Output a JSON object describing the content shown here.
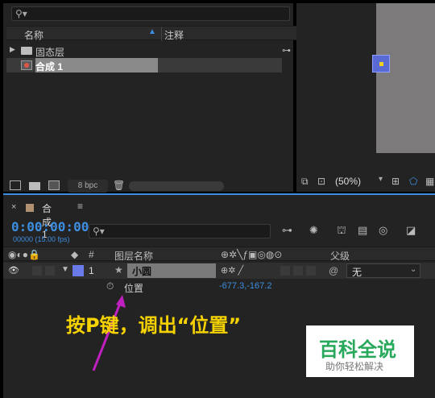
{
  "project": {
    "search_icon": "search-icon",
    "col_name": "名称",
    "col_comment": "注释",
    "items": [
      {
        "label": "固态层",
        "type": "folder"
      },
      {
        "label": "合成 1",
        "type": "composition"
      }
    ],
    "bpc": "8 bpc"
  },
  "viewer": {
    "zoom": "(50%)"
  },
  "timeline": {
    "tab_label": "合成 1",
    "timecode": "0:00:00:00",
    "fps": "00000 (15.00 fps)",
    "columns": {
      "num": "#",
      "layer_name": "图层名称",
      "parent": "父级"
    },
    "layer": {
      "number": "1",
      "name": "小圆",
      "parent": "无"
    },
    "property": {
      "name": "位置",
      "value": "-677.3,-167.2"
    }
  },
  "annotation": "按P键，调出“位置”",
  "watermark": {
    "title": "百科全说",
    "subtitle": "助你轻松解决"
  },
  "colors": {
    "accent": "#3d8ee0",
    "annotation": "#f5d200",
    "arrow": "#c020c0",
    "label": "#6a7ae8",
    "watermark": "#27a85a"
  }
}
